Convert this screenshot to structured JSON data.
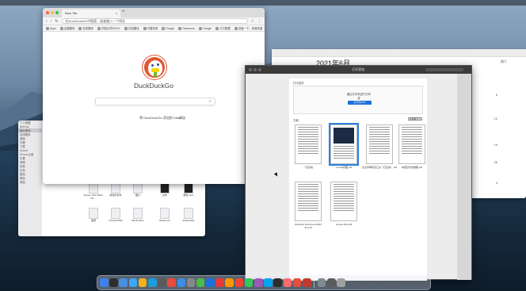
{
  "browser": {
    "tab_title": "New Tab",
    "tab_close": "×",
    "tab_add": "+",
    "omnibox": "在DuckDuckGo中搜索，或者输入一个网址",
    "bookmarks": [
      "Apps",
      "百度翻译",
      "在线翻译",
      "中国大学MOOC",
      "在线翻译",
      "中国知网",
      "Google",
      "Classroom",
      "Google",
      "万方数据",
      "百度一下，你就知道"
    ],
    "ddg_title": "DuckDuckGo",
    "add_text": "将 DuckDuckGo 添加到 Safari",
    "add_link": "添加"
  },
  "calendar": {
    "month": "2021年6月",
    "side_numbers": [
      "周六",
      "5",
      "12",
      "19",
      "26",
      "3"
    ]
  },
  "finder": {
    "sidebar": [
      "个人收藏",
      "AirDrop",
      "最近使用",
      "应用程序",
      "桌面",
      "文稿",
      "下载",
      "iCloud",
      "iCloud 云盘",
      "位置",
      "网络",
      "标签",
      "红色",
      "橙色",
      "黄色",
      "绿色"
    ],
    "items": [
      "Screen Shot 2021-06-...",
      "新建文件夹",
      "图片",
      "文件",
      "报告.docx",
      "截屏",
      "ChineseSSD",
      "Bookmarks",
      "Reference",
      "Downloads",
      "Document",
      "截屏2021"
    ]
  },
  "print": {
    "window_title": "打印预览",
    "section_top": "打印选项",
    "top_text": "通过打印机进行打印",
    "top_sub": "或",
    "button": "打印为PDF",
    "section_docs": "文稿",
    "docs_link": "选择要打印",
    "docs": [
      {
        "label": "一页文档",
        "selected": false,
        "dark": false
      },
      {
        "label": "e-book封面.pdf",
        "selected": true,
        "dark": true
      },
      {
        "label": "论文评审意见汇总（已反馈）.pdf",
        "selected": false,
        "dark": false
      },
      {
        "label": "中国近代史纲要.pdf",
        "selected": false,
        "dark": false
      },
      {
        "label": "Scientific Document-2021 Sci.pdf",
        "selected": false,
        "dark": false
      },
      {
        "label": "Invoice-001.pdf",
        "selected": false,
        "dark": false
      }
    ]
  },
  "dock": {
    "colors": [
      "#3f80f1",
      "#2e2e2e",
      "#4a90e2",
      "#3fa8f5",
      "#f3b11c",
      "#1b9dd9",
      "#5a5a5a",
      "#e74c3c",
      "#3a8ee6",
      "#888",
      "#4cbb4a",
      "#1d6fe0",
      "#e53935",
      "#ff9500",
      "#f44336",
      "#34c759",
      "#9b59b6",
      "#00a4ef",
      "#2d2d2d",
      "#ff6b6b",
      "#e74c3c",
      "#c0392b",
      "#7f8c8d",
      "#5b5b5b",
      "#a0a0a0"
    ]
  },
  "colors": {
    "ddg_orange": "#de5833",
    "accent_blue": "#1e6fd9"
  }
}
